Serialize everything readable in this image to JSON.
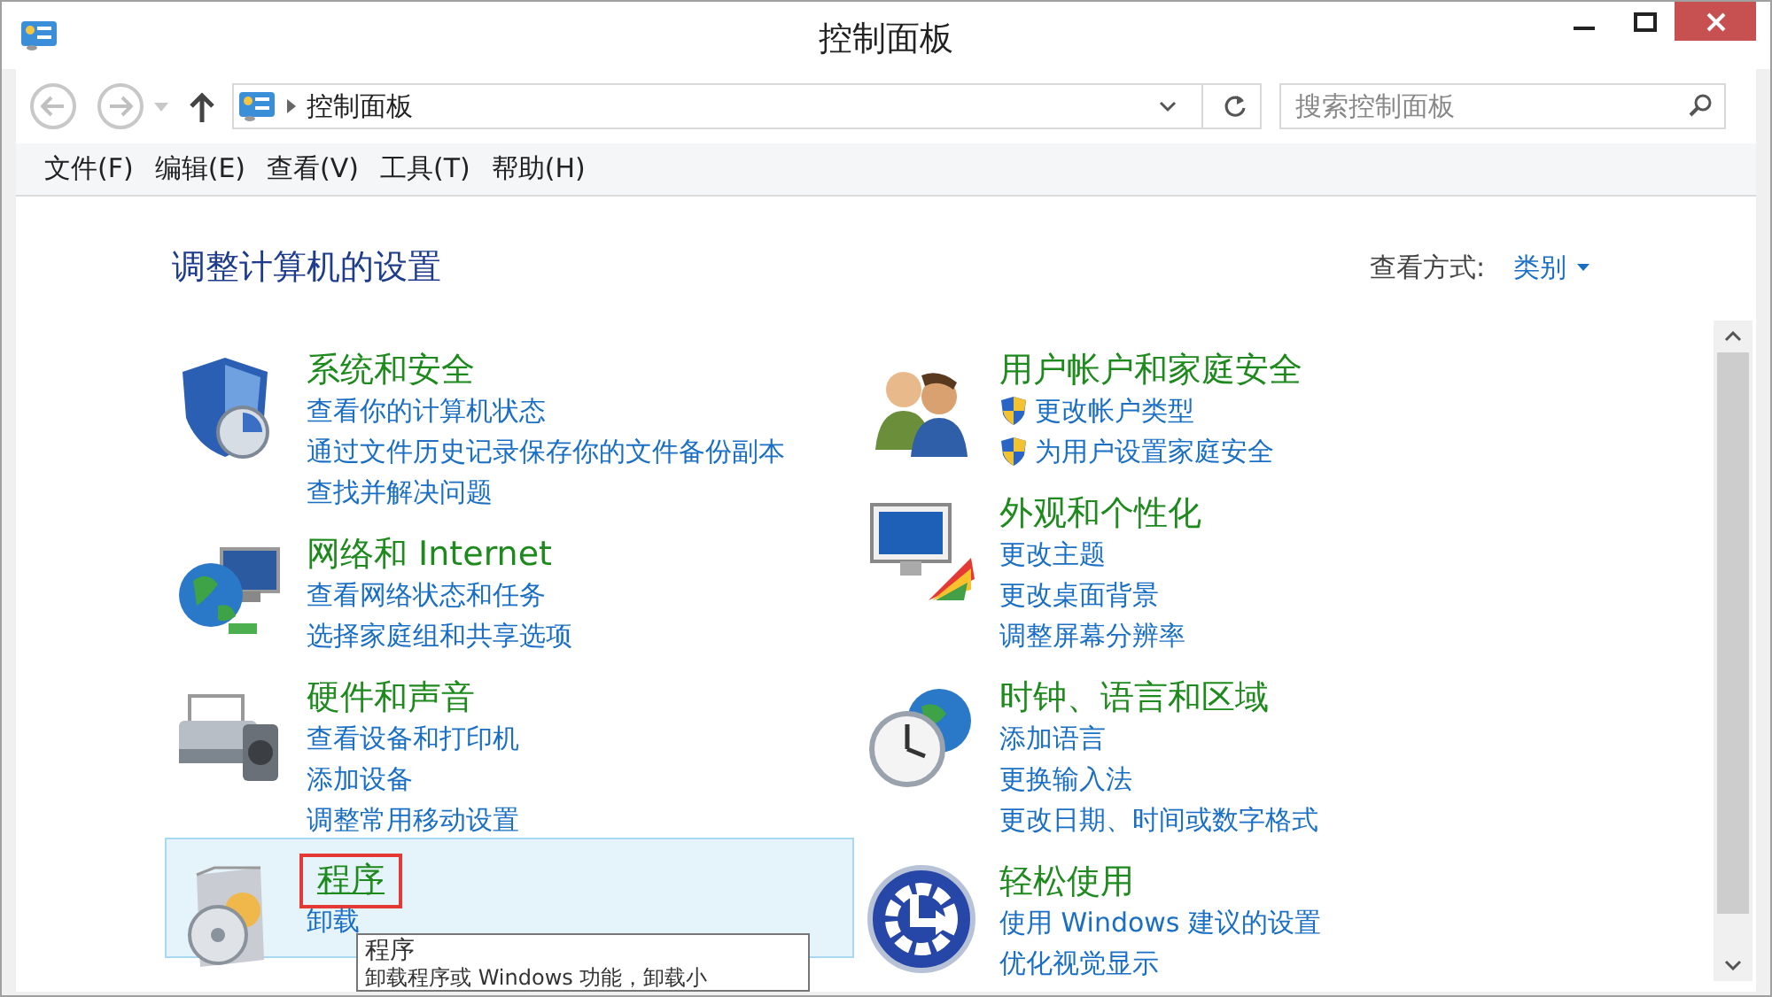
{
  "window": {
    "title": "控制面板"
  },
  "nav": {
    "breadcrumb": "控制面板",
    "search_placeholder": "搜索控制面板"
  },
  "menu": [
    "文件(F)",
    "编辑(E)",
    "查看(V)",
    "工具(T)",
    "帮助(H)"
  ],
  "heading": "调整计算机的设置",
  "view_by": {
    "label": "查看方式:",
    "value": "类别"
  },
  "categories": [
    {
      "kind": "security",
      "title": "系统和安全",
      "hovered": false,
      "highlighted": false,
      "links": [
        {
          "text": "查看你的计算机状态",
          "shield": false
        },
        {
          "text": "通过文件历史记录保存你的文件备份副本",
          "shield": false
        },
        {
          "text": "查找并解决问题",
          "shield": false
        }
      ]
    },
    {
      "kind": "network",
      "title": "网络和 Internet",
      "hovered": false,
      "highlighted": false,
      "links": [
        {
          "text": "查看网络状态和任务",
          "shield": false
        },
        {
          "text": "选择家庭组和共享选项",
          "shield": false
        }
      ]
    },
    {
      "kind": "hardware",
      "title": "硬件和声音",
      "hovered": false,
      "highlighted": false,
      "links": [
        {
          "text": "查看设备和打印机",
          "shield": false
        },
        {
          "text": "添加设备",
          "shield": false
        },
        {
          "text": "调整常用移动设置",
          "shield": false
        }
      ]
    },
    {
      "kind": "programs",
      "title": "程序",
      "hovered": true,
      "highlighted": true,
      "links": [
        {
          "text": "卸载",
          "shield": false
        }
      ]
    },
    {
      "kind": "users",
      "title": "用户帐户和家庭安全",
      "hovered": false,
      "highlighted": false,
      "links": [
        {
          "text": "更改帐户类型",
          "shield": true
        },
        {
          "text": "为用户设置家庭安全",
          "shield": true
        }
      ]
    },
    {
      "kind": "appearance",
      "title": "外观和个性化",
      "hovered": false,
      "highlighted": false,
      "links": [
        {
          "text": "更改主题",
          "shield": false
        },
        {
          "text": "更改桌面背景",
          "shield": false
        },
        {
          "text": "调整屏幕分辨率",
          "shield": false
        }
      ]
    },
    {
      "kind": "clock",
      "title": "时钟、语言和区域",
      "hovered": false,
      "highlighted": false,
      "links": [
        {
          "text": "添加语言",
          "shield": false
        },
        {
          "text": "更换输入法",
          "shield": false
        },
        {
          "text": "更改日期、时间或数字格式",
          "shield": false
        }
      ]
    },
    {
      "kind": "ease",
      "title": "轻松使用",
      "hovered": false,
      "highlighted": false,
      "links": [
        {
          "text": "使用 Windows 建议的设置",
          "shield": false
        },
        {
          "text": "优化视觉显示",
          "shield": false
        }
      ]
    }
  ],
  "tooltip": {
    "title": "程序",
    "text": "卸载程序或 Windows 功能，卸载小"
  }
}
